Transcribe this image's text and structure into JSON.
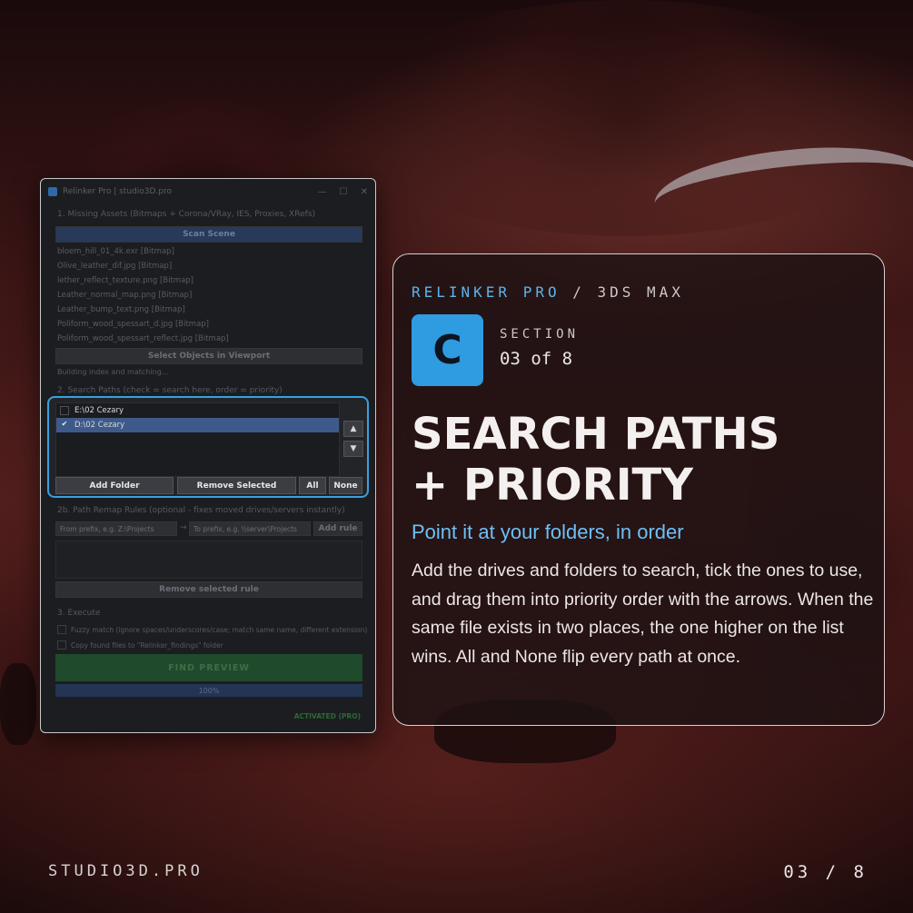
{
  "app": {
    "title": "Relinker Pro | studio3D.pro",
    "section1": "1. Missing Assets (Bitmaps + Corona/VRay, IES, Proxies, XRefs)",
    "scan_button": "Scan Scene",
    "assets": [
      "bloem_hill_01_4k.exr   [Bitmap]",
      "Olive_leather_dif.jpg   [Bitmap]",
      "lether_reflect_texture.png   [Bitmap]",
      "Leather_normal_map.png   [Bitmap]",
      "Leather_bump_text.png   [Bitmap]",
      "Poliform_wood_spessart_d.jpg   [Bitmap]",
      "Poliform_wood_spessart_reflect.jpg   [Bitmap]"
    ],
    "select_objects_button": "Select Objects in Viewport",
    "status": "Building index and matching...",
    "section2": "2. Search Paths (check = search here, order = priority)",
    "paths": [
      {
        "label": "E:\\02 Cezary",
        "checked": false,
        "selected": false
      },
      {
        "label": "D:\\02 Cezary",
        "checked": true,
        "selected": true
      }
    ],
    "up_arrow": "▲",
    "down_arrow": "▼",
    "add_folder": "Add Folder",
    "remove_selected": "Remove Selected",
    "all": "All",
    "none": "None",
    "section2b": "2b. Path Remap Rules (optional - fixes moved drives/servers instantly)",
    "from_placeholder": "From prefix, e.g.  Z:\\Projects",
    "to_placeholder": "To prefix, e.g.  \\\\server\\Projects",
    "remap_arrow": "→",
    "add_rule": "Add rule",
    "remove_rule": "Remove selected rule",
    "section3": "3. Execute",
    "fuzzy_label": "Fuzzy match (ignore spaces/underscores/case; match same name, different extension)",
    "copy_label": "Copy found files to \"Relinker_findings\" folder",
    "find_preview": "FIND  PREVIEW",
    "progress_label": "100%",
    "progress": 1.0,
    "activated": "ACTIVATED (PRO)"
  },
  "card": {
    "kicker_brand": "RELINKER PRO",
    "kicker_sep": " / ",
    "kicker_product": "3DS MAX",
    "badge": "C",
    "section_label": "SECTION",
    "section_num": "03 of 8",
    "headline_1": "SEARCH PATHS",
    "headline_2": "+ PRIORITY",
    "subtitle": "Point it at your folders, in order",
    "body": "Add the drives and folders to search, tick the ones to use, and drag them into priority order with the arrows. When the same file exists in two places, the one higher on the list wins. All and None flip every path at once."
  },
  "footer": {
    "brand": "STUDIO3D.PRO",
    "page": "03 / 8"
  },
  "colors": {
    "accent": "#3aa0e0",
    "badge": "#2f9be0",
    "subtitle": "#6cc0f5",
    "find_green": "#1f4a2b",
    "activated_green": "#2a6a34"
  }
}
